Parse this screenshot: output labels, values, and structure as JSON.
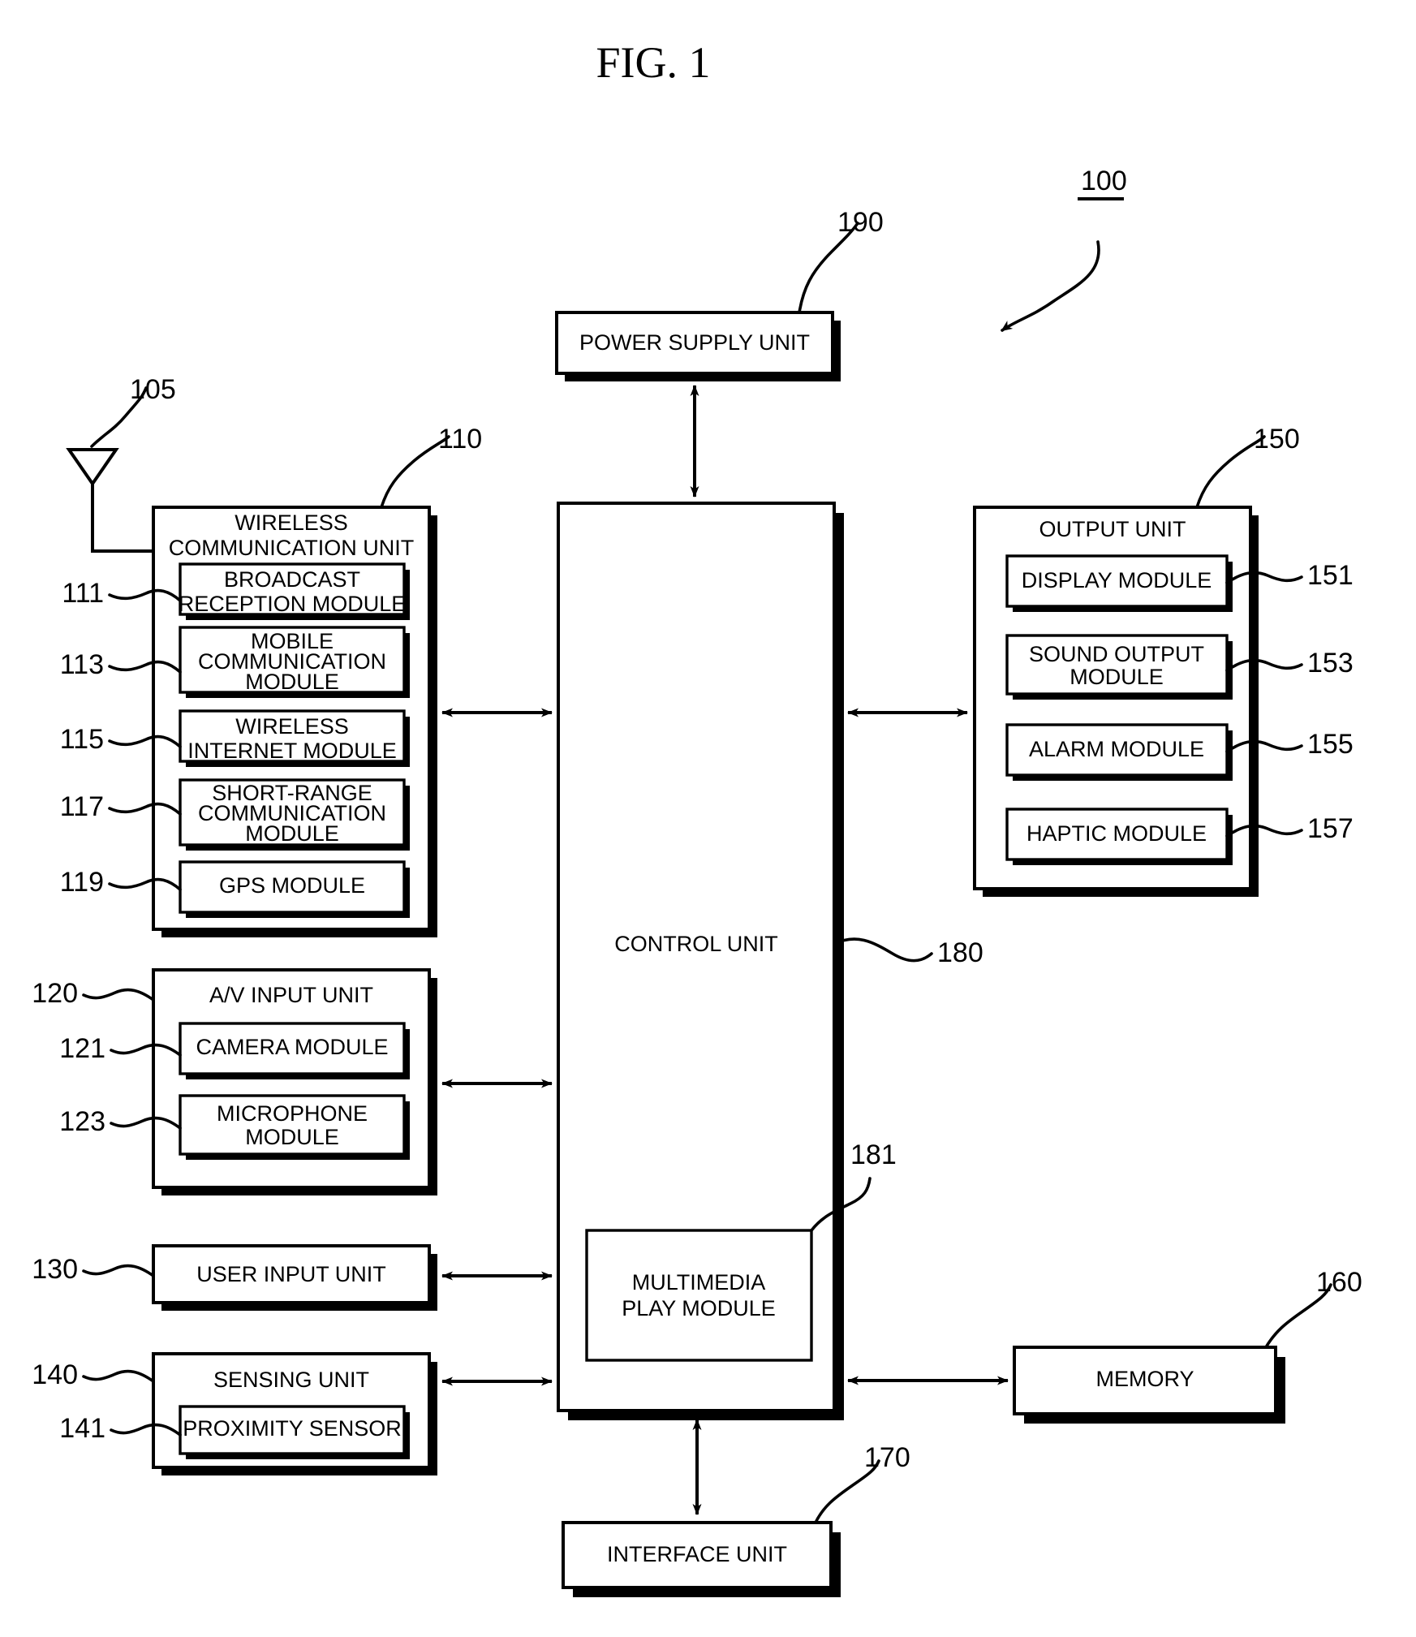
{
  "figure": {
    "title": "FIG. 1",
    "device_ref": "100",
    "antenna_ref": "105"
  },
  "blocks": {
    "power_supply": {
      "label": "POWER SUPPLY UNIT",
      "ref": "190"
    },
    "wireless_unit": {
      "label_line1": "WIRELESS",
      "label_line2": "COMMUNICATION UNIT",
      "ref": "110"
    },
    "broadcast": {
      "label_line1": "BROADCAST",
      "label_line2": "RECEPTION MODULE",
      "ref": "111"
    },
    "mobile_comm": {
      "label_line1": "MOBILE",
      "label_line2": "COMMUNICATION",
      "label_line3": "MODULE",
      "ref": "113"
    },
    "wireless_internet": {
      "label_line1": "WIRELESS",
      "label_line2": "INTERNET MODULE",
      "ref": "115"
    },
    "short_range": {
      "label_line1": "SHORT-RANGE",
      "label_line2": "COMMUNICATION",
      "label_line3": "MODULE",
      "ref": "117"
    },
    "gps": {
      "label": "GPS MODULE",
      "ref": "119"
    },
    "av_input": {
      "label": "A/V INPUT UNIT",
      "ref": "120"
    },
    "camera": {
      "label": "CAMERA MODULE",
      "ref": "121"
    },
    "microphone": {
      "label_line1": "MICROPHONE",
      "label_line2": "MODULE",
      "ref": "123"
    },
    "user_input": {
      "label": "USER INPUT UNIT",
      "ref": "130"
    },
    "sensing": {
      "label": "SENSING UNIT",
      "ref": "140"
    },
    "proximity": {
      "label": "PROXIMITY SENSOR",
      "ref": "141"
    },
    "output_unit": {
      "label": "OUTPUT UNIT",
      "ref": "150"
    },
    "display": {
      "label": "DISPLAY MODULE",
      "ref": "151"
    },
    "sound_output": {
      "label_line1": "SOUND OUTPUT",
      "label_line2": "MODULE",
      "ref": "153"
    },
    "alarm": {
      "label": "ALARM MODULE",
      "ref": "155"
    },
    "haptic": {
      "label": "HAPTIC MODULE",
      "ref": "157"
    },
    "memory": {
      "label": "MEMORY",
      "ref": "160"
    },
    "interface": {
      "label": "INTERFACE UNIT",
      "ref": "170"
    },
    "control_unit": {
      "label": "CONTROL UNIT",
      "ref": "180"
    },
    "multimedia": {
      "label_line1": "MULTIMEDIA",
      "label_line2": "PLAY MODULE",
      "ref": "181"
    }
  }
}
